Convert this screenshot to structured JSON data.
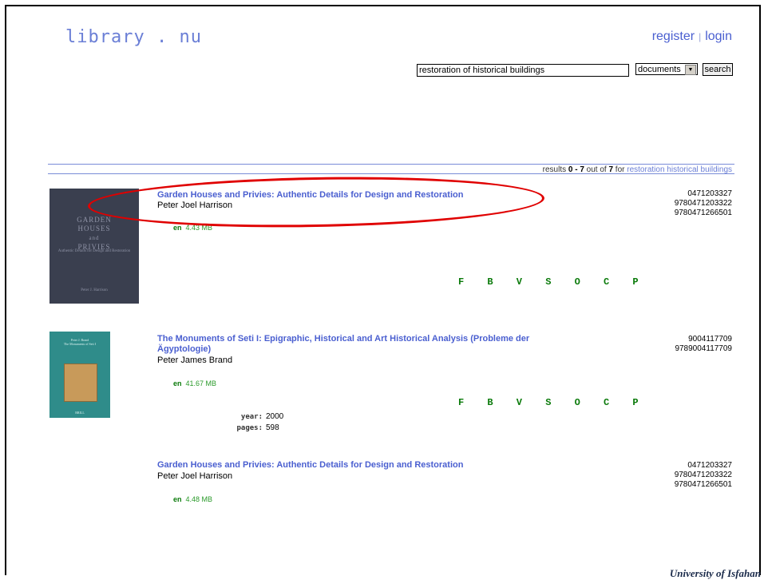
{
  "logo": "library . nu",
  "auth": {
    "register": "register",
    "separator": "|",
    "login": "login"
  },
  "search": {
    "query": "restoration of historical buildings",
    "type_selected": "documents",
    "button_label": "search"
  },
  "summary": {
    "prefix": "results ",
    "range": "0 - 7",
    "middle": " out of ",
    "total": "7",
    "suffix": " for ",
    "query_link": "restoration historical buildings"
  },
  "format_letters": "F B V S O C P",
  "results": [
    {
      "title": "Garden Houses and Privies: Authentic Details for Design and Restoration",
      "author": "Peter Joel Harrison",
      "lang": "en",
      "size": "4.43 MB",
      "isbn": [
        "0471203327",
        "9780471203322",
        "9780471266501"
      ],
      "cover": {
        "title_lines": "GARDEN\nHOUSES\nand\nPRIVIES",
        "subtitle": "Authentic Details for Design and Restoration",
        "author": "Peter J. Harrison"
      }
    },
    {
      "title_line1": "The Monuments of Seti I: Epigraphic, Historical and Art Historical Analysis (Probleme der",
      "title_line2": "Ägyptologie)",
      "author": "Peter James Brand",
      "lang": "en",
      "size": "41.67 MB",
      "isbn": [
        "9004117709",
        "9789004117709"
      ],
      "year_label": "year:",
      "year": "2000",
      "pages_label": "pages:",
      "pages": "598",
      "cover": {
        "title_lines": "Peter J. Brand\nThe Monuments of Seti I",
        "publisher": "BRILL"
      }
    },
    {
      "title": "Garden Houses and Privies: Authentic Details for Design and Restoration",
      "author": "Peter Joel Harrison",
      "lang": "en",
      "size": "4.48 MB",
      "isbn": [
        "0471203327",
        "9780471203322",
        "9780471266501"
      ]
    }
  ],
  "footer": {
    "institution": "University of Isfahan"
  },
  "colors": {
    "link": "#4a5fd0",
    "green": "#0a7a0a",
    "annotation": "#e00000"
  }
}
